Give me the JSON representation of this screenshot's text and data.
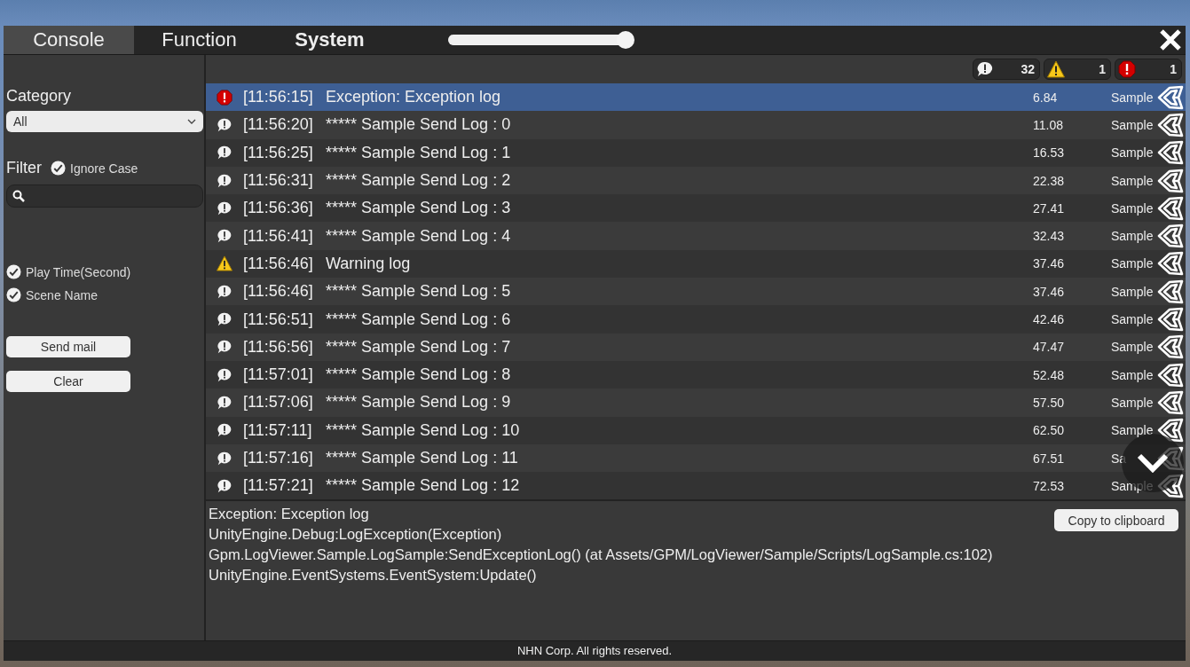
{
  "tabs": [
    {
      "label": "Console",
      "selected": true,
      "bold": false
    },
    {
      "label": "Function",
      "selected": false,
      "bold": false
    },
    {
      "label": "System",
      "selected": false,
      "bold": true
    }
  ],
  "zoom_slider": {
    "level": 1
  },
  "sidebar": {
    "category_label": "Category",
    "category_value": "All",
    "filter_label": "Filter",
    "ignore_case": {
      "label": "Ignore Case",
      "checked": true
    },
    "options": [
      {
        "label": "Play Time(Second)",
        "checked": true
      },
      {
        "label": "Scene Name",
        "checked": true
      }
    ],
    "buttons": [
      "Send mail",
      "Clear"
    ]
  },
  "counts": [
    {
      "kind": "info",
      "count": "32"
    },
    {
      "kind": "warning",
      "count": "1"
    },
    {
      "kind": "error",
      "count": "1"
    }
  ],
  "logs": [
    {
      "kind": "error",
      "selected": true,
      "time": "[11:56:15]",
      "message": "Exception: Exception log",
      "play_time": "6.84",
      "scene": "Sample"
    },
    {
      "kind": "info",
      "selected": false,
      "time": "[11:56:20]",
      "message": "***** Sample Send Log : 0",
      "play_time": "11.08",
      "scene": "Sample"
    },
    {
      "kind": "info",
      "selected": false,
      "time": "[11:56:25]",
      "message": "***** Sample Send Log : 1",
      "play_time": "16.53",
      "scene": "Sample"
    },
    {
      "kind": "info",
      "selected": false,
      "time": "[11:56:31]",
      "message": "***** Sample Send Log : 2",
      "play_time": "22.38",
      "scene": "Sample"
    },
    {
      "kind": "info",
      "selected": false,
      "time": "[11:56:36]",
      "message": "***** Sample Send Log : 3",
      "play_time": "27.41",
      "scene": "Sample"
    },
    {
      "kind": "info",
      "selected": false,
      "time": "[11:56:41]",
      "message": "***** Sample Send Log : 4",
      "play_time": "32.43",
      "scene": "Sample"
    },
    {
      "kind": "warning",
      "selected": false,
      "time": "[11:56:46]",
      "message": "Warning log",
      "play_time": "37.46",
      "scene": "Sample"
    },
    {
      "kind": "info",
      "selected": false,
      "time": "[11:56:46]",
      "message": "***** Sample Send Log : 5",
      "play_time": "37.46",
      "scene": "Sample"
    },
    {
      "kind": "info",
      "selected": false,
      "time": "[11:56:51]",
      "message": "***** Sample Send Log : 6",
      "play_time": "42.46",
      "scene": "Sample"
    },
    {
      "kind": "info",
      "selected": false,
      "time": "[11:56:56]",
      "message": "***** Sample Send Log : 7",
      "play_time": "47.47",
      "scene": "Sample"
    },
    {
      "kind": "info",
      "selected": false,
      "time": "[11:57:01]",
      "message": "***** Sample Send Log : 8",
      "play_time": "52.48",
      "scene": "Sample"
    },
    {
      "kind": "info",
      "selected": false,
      "time": "[11:57:06]",
      "message": "***** Sample Send Log : 9",
      "play_time": "57.50",
      "scene": "Sample"
    },
    {
      "kind": "info",
      "selected": false,
      "time": "[11:57:11]",
      "message": "***** Sample Send Log : 10",
      "play_time": "62.50",
      "scene": "Sample"
    },
    {
      "kind": "info",
      "selected": false,
      "time": "[11:57:16]",
      "message": "***** Sample Send Log : 11",
      "play_time": "67.51",
      "scene": "Sa"
    },
    {
      "kind": "info",
      "selected": false,
      "time": "[11:57:21]",
      "message": "***** Sample Send Log : 12",
      "play_time": "72.53",
      "scene": "Sample"
    }
  ],
  "detail": {
    "lines": [
      "Exception: Exception log",
      "UnityEngine.Debug:LogException(Exception)",
      "Gpm.LogViewer.Sample.LogSample:SendExceptionLog() (at Assets/GPM/LogViewer/Sample/Scripts/LogSample.cs:102)",
      "UnityEngine.EventSystems.EventSystem:Update()"
    ],
    "copy_button": "Copy to clipboard"
  },
  "footer": "NHN Corp. All rights reserved."
}
